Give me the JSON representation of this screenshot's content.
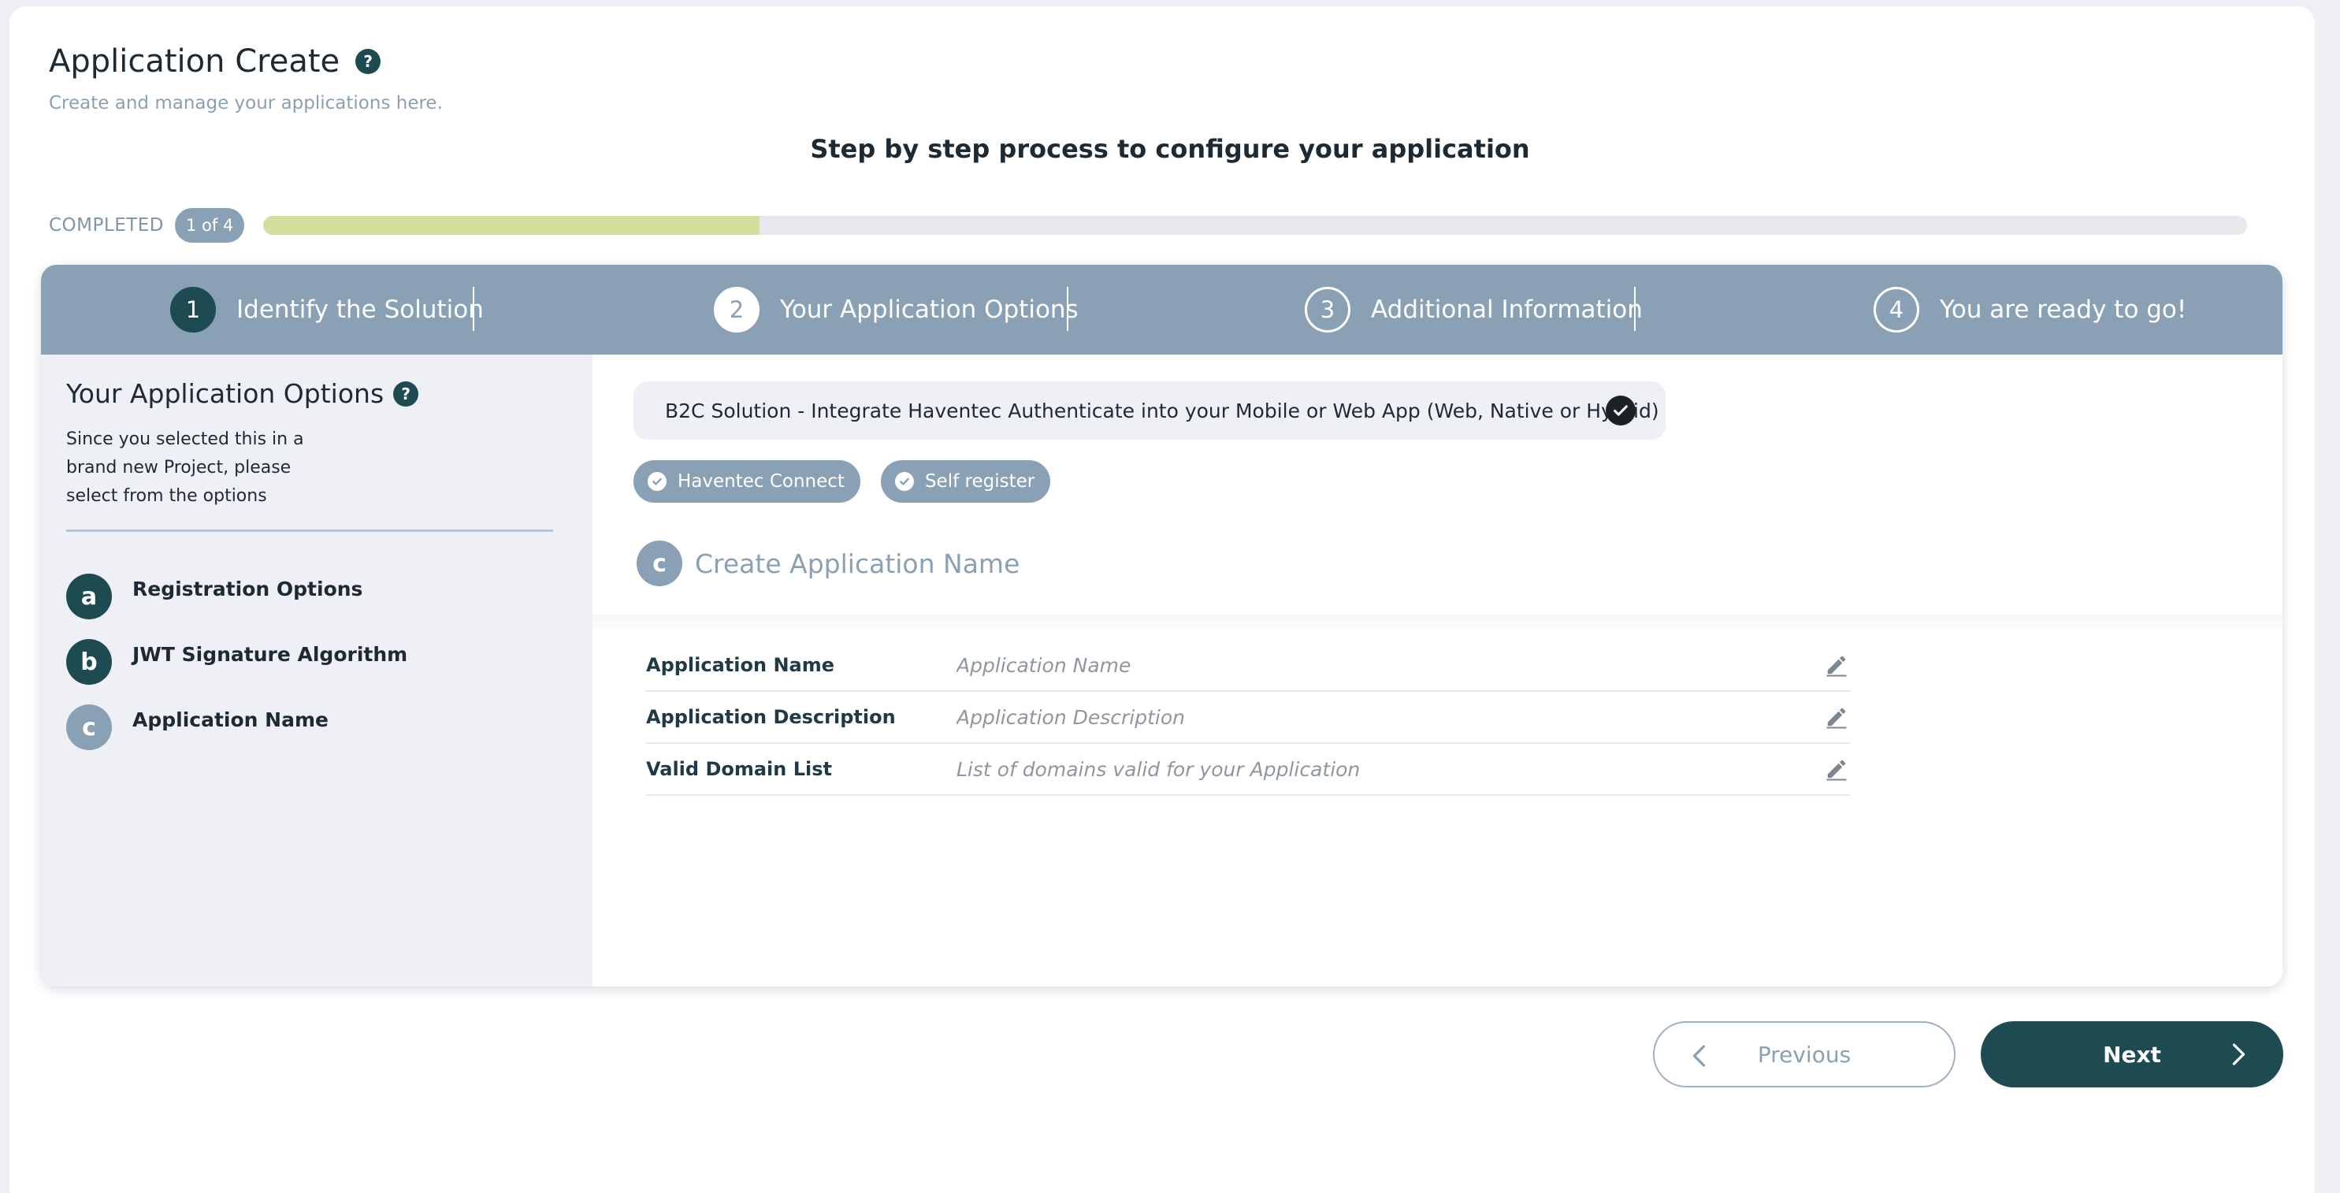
{
  "header": {
    "title": "Application Create",
    "help": "?",
    "subtitle": "Create and manage your applications here.",
    "steps_heading": "Step by step process to configure your application"
  },
  "progress": {
    "label": "COMPLETED",
    "badge": "1 of 4",
    "fraction": 0.25,
    "fill_color": "#d4df9c"
  },
  "steps": [
    {
      "num": "1",
      "label": "Identify the Solution",
      "state": "completed"
    },
    {
      "num": "2",
      "label": "Your Application Options",
      "state": "current"
    },
    {
      "num": "3",
      "label": "Additional Information",
      "state": "pending"
    },
    {
      "num": "4",
      "label": "You are ready to go!",
      "state": "pending"
    }
  ],
  "sidebar": {
    "title": "Your Application Options",
    "help": "?",
    "description": "Since you selected this in a brand new Project, please select from the options",
    "items": [
      {
        "letter": "a",
        "label": "Registration Options",
        "state": "done"
      },
      {
        "letter": "b",
        "label": "JWT Signature Algorithm",
        "state": "done"
      },
      {
        "letter": "c",
        "label": "Application Name",
        "state": "current"
      }
    ]
  },
  "main": {
    "solution": "B2C Solution - Integrate Haventec Authenticate into your Mobile or Web App (Web, Native or Hybrid)",
    "chips": [
      "Haventec Connect",
      "Self register"
    ],
    "section": {
      "letter": "c",
      "title": "Create Application Name"
    },
    "fields": [
      {
        "label": "Application Name",
        "placeholder": "Application Name",
        "value": ""
      },
      {
        "label": "Application Description",
        "placeholder": "Application Description",
        "value": ""
      },
      {
        "label": "Valid Domain List",
        "placeholder": "List of domains valid for your Application",
        "value": ""
      }
    ]
  },
  "footer": {
    "previous_label": "Previous",
    "next_label": "Next"
  },
  "colors": {
    "primary": "#1e4a52",
    "step_bar": "#8aa0b5",
    "muted": "#8aa0b4"
  }
}
